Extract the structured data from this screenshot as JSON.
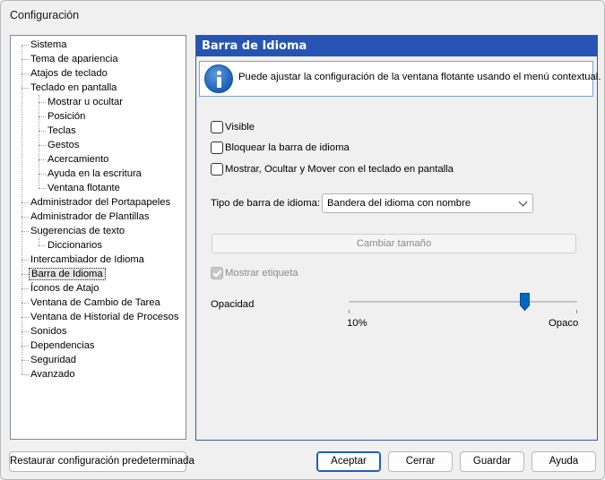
{
  "window": {
    "title": "Configuración"
  },
  "tree": {
    "items": [
      {
        "label": "Sistema",
        "level": 0
      },
      {
        "label": "Tema de apariencia",
        "level": 0
      },
      {
        "label": "Atajos de teclado",
        "level": 0
      },
      {
        "label": "Teclado en pantalla",
        "level": 0
      },
      {
        "label": "Mostrar u ocultar",
        "level": 1
      },
      {
        "label": "Posición",
        "level": 1
      },
      {
        "label": "Teclas",
        "level": 1
      },
      {
        "label": "Gestos",
        "level": 1
      },
      {
        "label": "Acercamiento",
        "level": 1
      },
      {
        "label": "Ayuda en la escritura",
        "level": 1
      },
      {
        "label": "Ventana flotante",
        "level": 1
      },
      {
        "label": "Administrador del Portapapeles",
        "level": 0
      },
      {
        "label": "Administrador de Plantillas",
        "level": 0
      },
      {
        "label": "Sugerencias de texto",
        "level": 0
      },
      {
        "label": "Diccionarios",
        "level": 1
      },
      {
        "label": "Intercambiador de Idioma",
        "level": 0
      },
      {
        "label": "Barra de Idioma",
        "level": 0,
        "selected": true
      },
      {
        "label": "Íconos de Atajo",
        "level": 0
      },
      {
        "label": "Ventana de Cambio de Tarea",
        "level": 0
      },
      {
        "label": "Ventana de Historial de Procesos",
        "level": 0
      },
      {
        "label": "Sonidos",
        "level": 0
      },
      {
        "label": "Dependencias",
        "level": 0
      },
      {
        "label": "Seguridad",
        "level": 0
      },
      {
        "label": "Avanzado",
        "level": 0
      }
    ]
  },
  "panel": {
    "title": "Barra de Idioma",
    "info_icon": "info-icon",
    "info_text": "Puede ajustar la configuración de la ventana flotante usando el menú contextual.",
    "checkboxes": {
      "visible": {
        "label": "Visible",
        "checked": false
      },
      "lock": {
        "label": "Bloquear la barra de idioma",
        "checked": false
      },
      "keyboard": {
        "label": "Mostrar, Ocultar y Mover con el teclado en pantalla",
        "checked": false
      },
      "show_label": {
        "label": "Mostrar etiqueta",
        "checked": true,
        "disabled": true
      }
    },
    "bar_type": {
      "label": "Tipo de barra de idioma:",
      "value": "Bandera del idioma con nombre"
    },
    "resize_button": "Cambiar tamaño",
    "opacity": {
      "label": "Opacidad",
      "min_label": "10%",
      "max_label": "Opaco",
      "value_fraction": 0.77
    }
  },
  "buttons": {
    "restore": "Restaurar configuración predeterminada",
    "accept": "Aceptar",
    "close": "Cerrar",
    "save": "Guardar",
    "help": "Ayuda"
  },
  "colors": {
    "header_bg": "#2554b4",
    "accent": "#0067c0"
  }
}
